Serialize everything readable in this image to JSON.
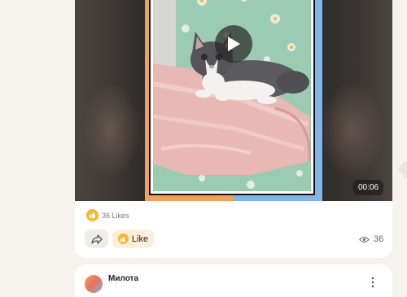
{
  "post": {
    "video": {
      "duration": "00:06",
      "icons": {
        "play": "play-icon"
      }
    },
    "reactions": {
      "emoji": "thumbs-up-icon",
      "likes_text": "36 Likes"
    },
    "actions": {
      "share_icon": "share-arrow-icon",
      "like_label": "Like",
      "views_icon": "eye-icon",
      "views_count": "36"
    }
  },
  "next_post": {
    "author": "Милота",
    "more_icon": "more-vertical-icon"
  },
  "colors": {
    "page_bg": "#f6f3ef",
    "card_bg": "#ffffff",
    "like_accent": "#f7b733",
    "like_button_bg": "#fdf0da"
  }
}
